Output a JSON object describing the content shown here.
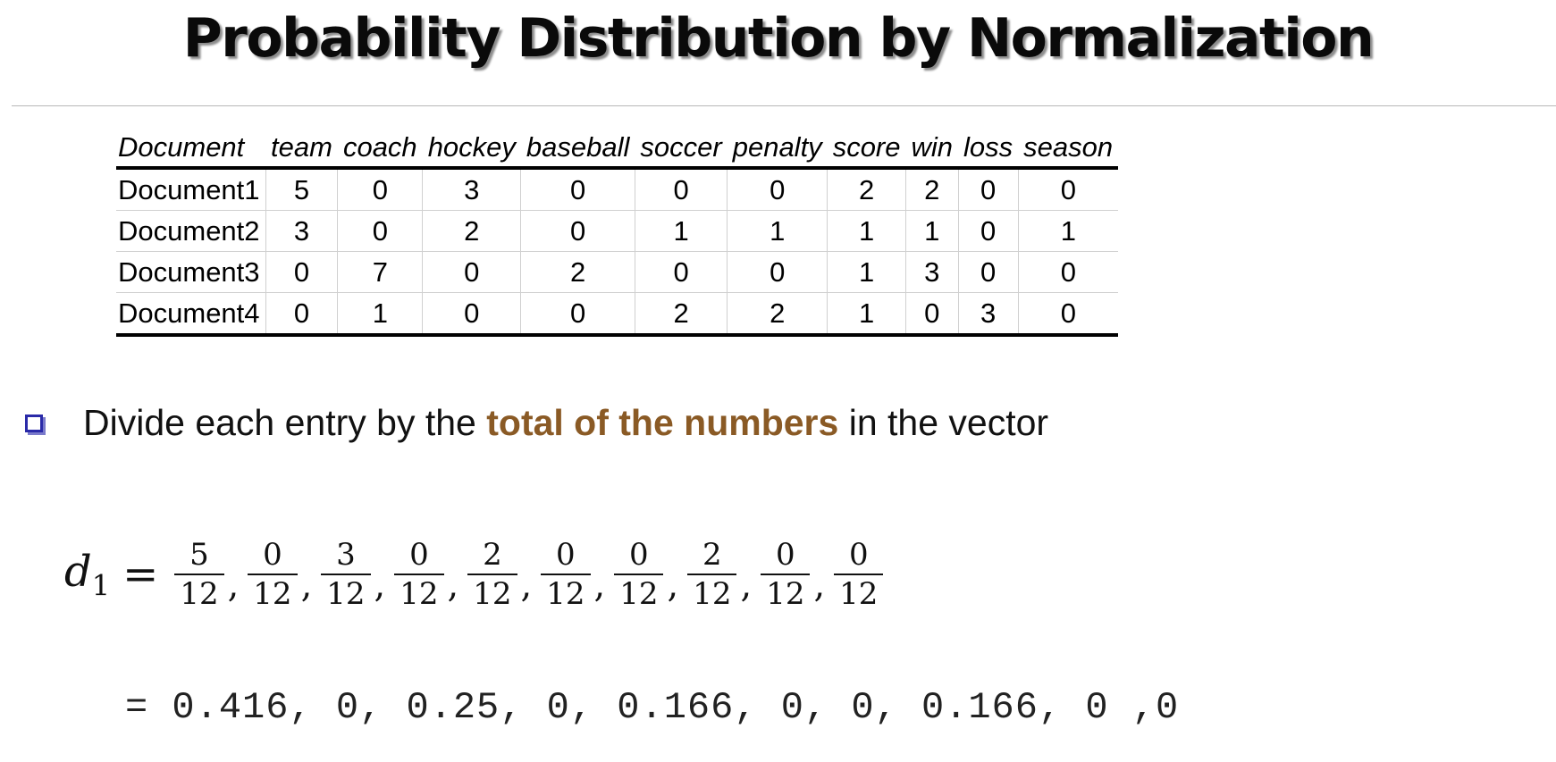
{
  "title": "Probability Distribution by Normalization",
  "table": {
    "headers": [
      "Document",
      "team",
      "coach",
      "hockey",
      "baseball",
      "soccer",
      "penalty",
      "score",
      "win",
      "loss",
      "season"
    ],
    "rows": [
      {
        "name": "Document1",
        "values": [
          "5",
          "0",
          "3",
          "0",
          "0",
          "0",
          "2",
          "2",
          "0",
          "0"
        ]
      },
      {
        "name": "Document2",
        "values": [
          "3",
          "0",
          "2",
          "0",
          "1",
          "1",
          "1",
          "1",
          "0",
          "1"
        ]
      },
      {
        "name": "Document3",
        "values": [
          "0",
          "7",
          "0",
          "2",
          "0",
          "0",
          "1",
          "3",
          "0",
          "0"
        ]
      },
      {
        "name": "Document4",
        "values": [
          "0",
          "1",
          "0",
          "0",
          "2",
          "2",
          "1",
          "0",
          "3",
          "0"
        ]
      }
    ]
  },
  "bullet": {
    "before": "Divide each entry by the ",
    "highlight": "total of the numbers",
    "after": " in the vector",
    "highlight_color": "#8a5a25"
  },
  "formula": {
    "lhs_var": "d",
    "lhs_sub": "1",
    "equals": "=",
    "fractions": [
      {
        "num": "5",
        "den": "12"
      },
      {
        "num": "0",
        "den": "12"
      },
      {
        "num": "3",
        "den": "12"
      },
      {
        "num": "0",
        "den": "12"
      },
      {
        "num": "2",
        "den": "12"
      },
      {
        "num": "0",
        "den": "12"
      },
      {
        "num": "0",
        "den": "12"
      },
      {
        "num": "2",
        "den": "12"
      },
      {
        "num": "0",
        "den": "12"
      },
      {
        "num": "0",
        "den": "12"
      }
    ],
    "separator": ","
  },
  "result": "= 0.416, 0, 0.25, 0, 0.166, 0, 0, 0.166, 0 ,0"
}
